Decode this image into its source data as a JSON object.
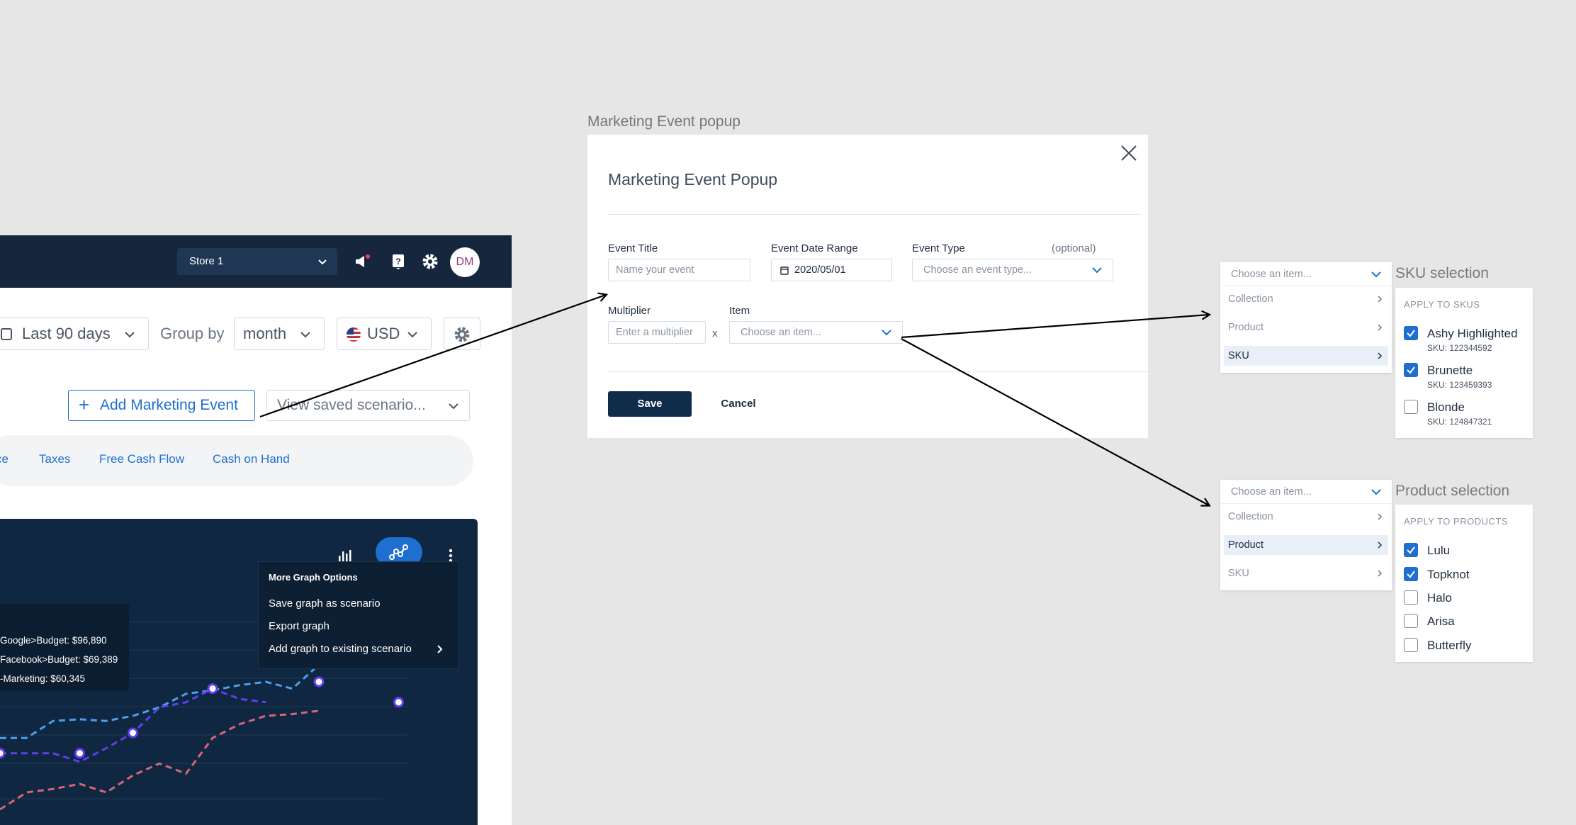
{
  "app": {
    "store": "Store 1",
    "avatar": "DM",
    "range": "Last 90 days",
    "group_by_label": "Group by",
    "group_by_value": "month",
    "currency": "USD",
    "add_event": "Add Marketing Event",
    "view_saved": "View saved scenario...",
    "tabs": [
      "ce",
      "Taxes",
      "Free Cash Flow",
      "Cash on Hand"
    ],
    "menu": {
      "heading": "More Graph Options",
      "items": [
        "Save graph as scenario",
        "Export graph",
        "Add graph to existing scenario"
      ]
    },
    "tooltip": [
      "Google>Budget: $96,890",
      "Facebook>Budget: $69,389",
      "-Marketing: $60,345"
    ],
    "colors": {
      "topbar": "#16273d",
      "accent": "#1f6fd1",
      "panel": "#0f2740"
    }
  },
  "chart_data": {
    "type": "line",
    "series": [
      {
        "values": [
          0.42,
          0.42,
          0.52,
          0.53,
          0.52,
          0.55,
          0.6,
          0.68,
          0.7,
          0.73,
          0.75,
          0.71,
          0.85
        ]
      },
      {
        "values": [
          0.33,
          0.33,
          0.33,
          0.28,
          0.36,
          0.45,
          0.6,
          0.63,
          0.71,
          0.65,
          0.63
        ]
      },
      {
        "values": [
          0.0,
          0.1,
          0.12,
          0.15,
          0.1,
          0.2,
          0.27,
          0.21,
          0.42,
          0.5,
          0.55,
          0.56,
          0.58
        ]
      }
    ],
    "series_colors": [
      "#4a9fee",
      "#5f3ff0",
      "#d9647a"
    ],
    "markers": [
      [
        0,
        0.33
      ],
      [
        3,
        0.33
      ],
      [
        5,
        0.45
      ],
      [
        8,
        0.71
      ],
      [
        12,
        0.75
      ],
      [
        15,
        0.63
      ]
    ]
  },
  "popup_frame_label": "Marketing Event popup",
  "popup": {
    "title": "Marketing Event Popup",
    "event_title_label": "Event Title",
    "event_title_placeholder": "Name your event",
    "date_range_label": "Event Date Range",
    "date_value": "2020/05/01",
    "event_type_label": "Event Type",
    "optional": "(optional)",
    "event_type_placeholder": "Choose an event type...",
    "multiplier_label": "Multiplier",
    "multiplier_placeholder": "Enter a multiplier",
    "x": "x",
    "item_label": "Item",
    "item_placeholder": "Choose an item...",
    "save": "Save",
    "cancel": "Cancel"
  },
  "sku_dropdown": {
    "placeholder": "Choose an item...",
    "options": [
      "Collection",
      "Product",
      "SKU"
    ],
    "selected": "SKU"
  },
  "sku_panel": {
    "title": "SKU selection",
    "heading": "APPLY TO SKUS",
    "items": [
      {
        "name": "Ashy Highlighted",
        "sku": "SKU: 122344592",
        "checked": true
      },
      {
        "name": "Brunette",
        "sku": "SKU: 123459393",
        "checked": true
      },
      {
        "name": "Blonde",
        "sku": "SKU: 124847321",
        "checked": false
      }
    ]
  },
  "product_dropdown": {
    "placeholder": "Choose an item...",
    "options": [
      "Collection",
      "Product",
      "SKU"
    ],
    "selected": "Product"
  },
  "product_panel": {
    "title": "Product selection",
    "heading": "APPLY TO PRODUCTS",
    "items": [
      {
        "name": "Lulu",
        "checked": true
      },
      {
        "name": "Topknot",
        "checked": true
      },
      {
        "name": "Halo",
        "checked": false
      },
      {
        "name": "Arisa",
        "checked": false
      },
      {
        "name": "Butterfly",
        "checked": false
      }
    ]
  }
}
